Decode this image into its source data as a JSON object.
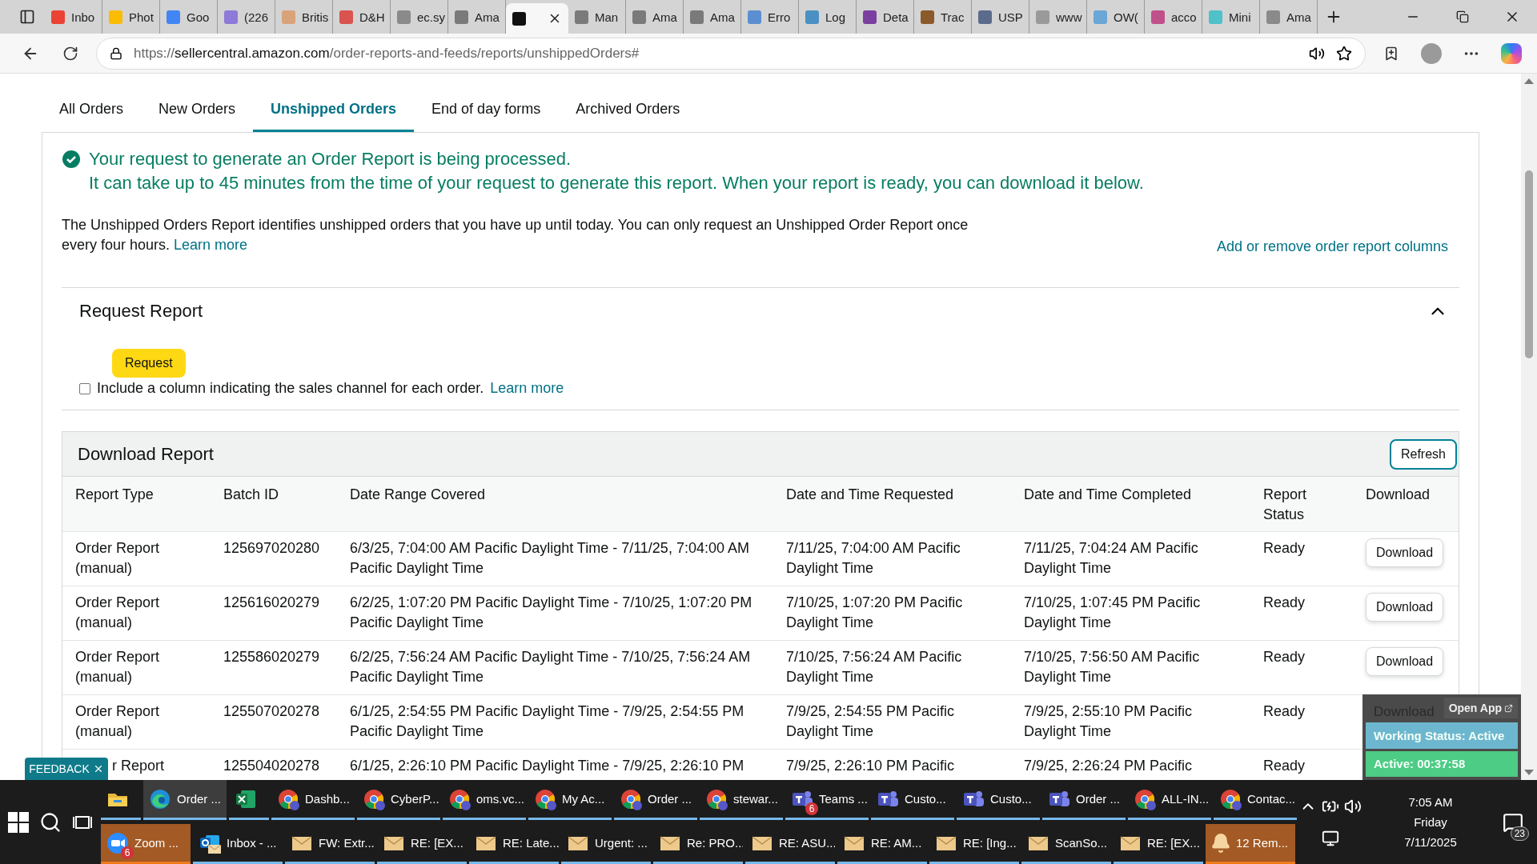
{
  "browser": {
    "tabs": [
      {
        "label": "Inbo",
        "color": "#ea4335",
        "selected": false
      },
      {
        "label": "Phot",
        "color": "#fbbc04",
        "selected": false
      },
      {
        "label": "Goo",
        "color": "#4285f4",
        "selected": false
      },
      {
        "label": "(226",
        "color": "#8e7ad8",
        "selected": false
      },
      {
        "label": "Britis",
        "color": "#d9a37a",
        "selected": false
      },
      {
        "label": "D&H",
        "color": "#d9534f",
        "selected": false
      },
      {
        "label": "ec.sy",
        "color": "#8a8a8a",
        "selected": false
      },
      {
        "label": "Ama",
        "color": "#7a7a7a",
        "selected": false
      },
      {
        "color": "#111111",
        "selected": true
      },
      {
        "label": "Man",
        "color": "#7a7a7a",
        "selected": false
      },
      {
        "label": "Ama",
        "color": "#7a7a7a",
        "selected": false
      },
      {
        "label": "Ama",
        "color": "#7a7a7a",
        "selected": false
      },
      {
        "label": "Erro",
        "color": "#5b8fd1",
        "selected": false
      },
      {
        "label": "Log",
        "color": "#4a90c2",
        "selected": false
      },
      {
        "label": "Deta",
        "color": "#7b3fa0",
        "selected": false
      },
      {
        "label": "Trac",
        "color": "#8b5a2b",
        "selected": false
      },
      {
        "label": "USP",
        "color": "#5a6b8c",
        "selected": false
      },
      {
        "label": "www",
        "color": "#9a9a9a",
        "selected": false
      },
      {
        "label": "OW(",
        "color": "#6aa6d6",
        "selected": false
      },
      {
        "label": "acco",
        "color": "#c0508a",
        "selected": false
      },
      {
        "label": "Mini",
        "color": "#4fc1c8",
        "selected": false
      },
      {
        "label": "Ama",
        "color": "#8a8a8a",
        "selected": false
      }
    ],
    "url": {
      "prefix": "https://",
      "domain": "sellercentral.amazon.com",
      "path": "/order-reports-and-feeds/reports/unshippedOrders#"
    }
  },
  "nav_tabs": [
    {
      "label": "All Orders",
      "selected": false
    },
    {
      "label": "New Orders",
      "selected": false
    },
    {
      "label": "Unshipped Orders",
      "selected": true
    },
    {
      "label": "End of day forms",
      "selected": false
    },
    {
      "label": "Archived Orders",
      "selected": false
    }
  ],
  "notice": {
    "title": "Your request to generate an Order Report is being processed.",
    "detail": "It can take up to 45 minutes from the time of your request to generate this report. When your report is ready, you can download it below."
  },
  "description": {
    "text": "The Unshipped Orders Report identifies unshipped orders that you have up until today. You can only request an Unshipped Order Report once every four hours.",
    "link": "Learn more"
  },
  "columns_link": "Add or remove order report columns",
  "request_section": {
    "title": "Request Report",
    "expanded": true,
    "button": "Request",
    "checkbox": {
      "label": "Include a column indicating the sales channel for each order.",
      "checked": false,
      "link": "Learn more"
    }
  },
  "download_section": {
    "title": "Download Report",
    "refresh": "Refresh",
    "table": {
      "columns": [
        "Report Type",
        "Batch ID",
        "Date Range Covered",
        "Date and Time Requested",
        "Date and Time Completed",
        "Report Status",
        "Download"
      ],
      "rows": [
        {
          "cut": false,
          "cells": [
            "Order Report (manual)",
            "125697020280",
            "6/3/25, 7:04:00 AM Pacific Daylight Time - 7/11/25, 7:04:00 AM Pacific Daylight Time",
            "7/11/25, 7:04:00 AM Pacific Daylight Time",
            "7/11/25, 7:04:24 AM Pacific Daylight Time",
            "Ready"
          ],
          "download": "Download"
        },
        {
          "cut": false,
          "cells": [
            "Order Report (manual)",
            "125616020279",
            "6/2/25, 1:07:20 PM Pacific Daylight Time - 7/10/25, 1:07:20 PM Pacific Daylight Time",
            "7/10/25, 1:07:20 PM Pacific Daylight Time",
            "7/10/25, 1:07:45 PM Pacific Daylight Time",
            "Ready"
          ],
          "download": "Download"
        },
        {
          "cut": false,
          "cells": [
            "Order Report (manual)",
            "125586020279",
            "6/2/25, 7:56:24 AM Pacific Daylight Time - 7/10/25, 7:56:24 AM Pacific Daylight Time",
            "7/10/25, 7:56:24 AM Pacific Daylight Time",
            "7/10/25, 7:56:50 AM Pacific Daylight Time",
            "Ready"
          ],
          "download": "Download"
        },
        {
          "cut": false,
          "cells": [
            "Order Report (manual)",
            "125507020278",
            "6/1/25, 2:54:55 PM Pacific Daylight Time - 7/9/25, 2:54:55 PM Pacific Daylight Time",
            "7/9/25, 2:54:55 PM Pacific Daylight Time",
            "7/9/25, 2:55:10 PM Pacific Daylight Time",
            "Ready"
          ]
        },
        {
          "cut": true,
          "cells": [
            "r Report",
            "125504020278",
            "6/1/25, 2:26:10 PM Pacific Daylight Time - 7/9/25, 2:26:10 PM",
            "7/9/25, 2:26:10 PM Pacific",
            "7/9/25, 2:26:24 PM Pacific",
            "Ready"
          ]
        }
      ]
    }
  },
  "feedback": {
    "label": "FEEDBACK"
  },
  "status_widget": {
    "behind": "Download",
    "open_app": "Open App",
    "working_status": "Working Status: Active",
    "timer": "Active: 00:37:58"
  },
  "taskbar": {
    "row_1": [
      {
        "kind": "explorer",
        "selected": false,
        "flashing": false
      },
      {
        "kind": "edge",
        "label": "Order ...",
        "selected": true,
        "flashing": false
      },
      {
        "kind": "excel",
        "selected": false,
        "flashing": false
      },
      {
        "kind": "chrome",
        "label": "Dashb...",
        "selected": false,
        "flashing": false
      },
      {
        "kind": "chrome",
        "label": "CyberP...",
        "selected": false,
        "flashing": false
      },
      {
        "kind": "chrome",
        "label": "oms.vc...",
        "selected": false,
        "flashing": false
      },
      {
        "kind": "chrome",
        "label": "My Ac...",
        "selected": false,
        "flashing": false
      },
      {
        "kind": "chrome",
        "label": "Order ...",
        "selected": false,
        "flashing": false
      },
      {
        "kind": "chrome",
        "label": "stewar...",
        "selected": false,
        "flashing": false
      },
      {
        "kind": "teams",
        "label": "Teams ...",
        "badge": "6",
        "selected": false,
        "flashing": false
      },
      {
        "kind": "teams",
        "label": "Custo...",
        "selected": false,
        "flashing": false
      },
      {
        "kind": "teams",
        "label": "Custo...",
        "selected": false,
        "flashing": false
      },
      {
        "kind": "teams",
        "label": "Order ...",
        "selected": false,
        "flashing": false
      },
      {
        "kind": "chrome",
        "label": "ALL-IN...",
        "selected": false,
        "flashing": false
      },
      {
        "kind": "chrome",
        "label": "Contac...",
        "selected": false,
        "flashing": false
      }
    ],
    "row_2": [
      {
        "kind": "zoom",
        "label": "Zoom ...",
        "badge": "6",
        "selected": false,
        "flashing": true
      },
      {
        "kind": "outlook",
        "label": "Inbox - ...",
        "selected": false,
        "flashing": false
      },
      {
        "kind": "mail",
        "label": "FW: Extr...",
        "selected": false,
        "flashing": false
      },
      {
        "kind": "mail",
        "label": "RE: [EX...",
        "selected": false,
        "flashing": false
      },
      {
        "kind": "mail",
        "label": "RE: Late...",
        "selected": false,
        "flashing": false
      },
      {
        "kind": "mail",
        "label": "Urgent: ...",
        "selected": false,
        "flashing": false
      },
      {
        "kind": "mail",
        "label": "Re: PRO...",
        "selected": false,
        "flashing": false
      },
      {
        "kind": "mail",
        "label": "RE: ASU...",
        "selected": false,
        "flashing": false
      },
      {
        "kind": "mail",
        "label": "RE: AM...",
        "selected": false,
        "flashing": false
      },
      {
        "kind": "mail",
        "label": "RE: [Ing...",
        "selected": false,
        "flashing": false
      },
      {
        "kind": "mail",
        "label": "ScanSo...",
        "selected": false,
        "flashing": false
      },
      {
        "kind": "mail",
        "label": "RE: [EX...",
        "selected": false,
        "flashing": false
      },
      {
        "kind": "bell",
        "label": "12 Rem...",
        "selected": false,
        "flashing": true
      }
    ],
    "tray": {
      "time": "7:05 AM",
      "day": "Friday",
      "date": "7/11/2025",
      "notifications": "23"
    }
  }
}
